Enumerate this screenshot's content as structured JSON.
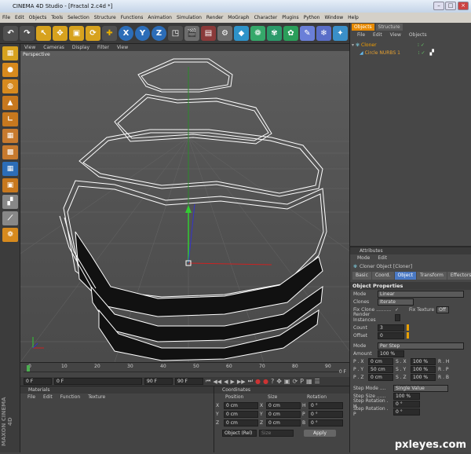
{
  "window": {
    "title": "CINEMA 4D Studio - [Fractal 2.c4d *]"
  },
  "menu": [
    "File",
    "Edit",
    "Objects",
    "Tools",
    "Selection",
    "Structure",
    "Functions",
    "Animation",
    "Simulation",
    "Render",
    "MoGraph",
    "Character",
    "Plugins",
    "Python",
    "Window",
    "Help"
  ],
  "viewport": {
    "menu": [
      "View",
      "Cameras",
      "Display",
      "Filter",
      "View"
    ],
    "label": "Perspective"
  },
  "timeline": {
    "ticks": [
      "0",
      "10",
      "20",
      "30",
      "40",
      "50",
      "60",
      "70",
      "80",
      "90"
    ],
    "end_label": "0 F",
    "start_field": "0 F",
    "cur_field": "0 F",
    "min_field": "90 F",
    "max_field": "90 F"
  },
  "materials": {
    "title": "Materials",
    "menu": [
      "File",
      "Edit",
      "Function",
      "Texture"
    ]
  },
  "coords": {
    "title": "Coordinates",
    "headers": [
      "Position",
      "Size",
      "Rotation"
    ],
    "rows": [
      {
        "axis": "X",
        "pos": "0 cm",
        "sz": "0 cm",
        "rl": "H",
        "rot": "0 °"
      },
      {
        "axis": "Y",
        "pos": "0 cm",
        "sz": "0 cm",
        "rl": "P",
        "rot": "0 °"
      },
      {
        "axis": "Z",
        "pos": "0 cm",
        "sz": "0 cm",
        "rl": "B",
        "rot": "0 °"
      }
    ],
    "mode": "Object (Rel)",
    "size_mode": "Size",
    "apply": "Apply"
  },
  "objects": {
    "tabs": [
      "Objects",
      "Structure"
    ],
    "menu": [
      "File",
      "Edit",
      "View",
      "Objects"
    ],
    "items": [
      {
        "name": "Cloner"
      },
      {
        "name": "Circle NURBS 1"
      }
    ]
  },
  "attributes": {
    "title": "Attributes",
    "menu": [
      "Mode",
      "Edit"
    ],
    "object_label": "Cloner Object [Cloner]",
    "tabs": [
      "Basic",
      "Coord.",
      "Object",
      "Transform",
      "Effectors"
    ],
    "section": "Object Properties",
    "mode_label": "Mode",
    "mode_value": "Linear",
    "clones_label": "Clones",
    "clones_value": "Iterate",
    "fix_clone": "Fix Clone ..........",
    "fix_texture": "Fix Texture",
    "fix_texture_value": "Off",
    "render_instances": "Render Instances",
    "count_label": "Count",
    "count_value": "3",
    "offset_label": "Offset",
    "offset_value": "0",
    "mode2_label": "Mode",
    "mode2_value": "Per Step",
    "amount_label": "Amount",
    "amount_value": "100 %",
    "grid": [
      {
        "l1": "P . X",
        "v1": "0 cm",
        "l2": "S . X",
        "v2": "100 %",
        "l3": "R . H"
      },
      {
        "l1": "P . Y",
        "v1": "50 cm",
        "l2": "S . Y",
        "v2": "100 %",
        "l3": "R . P"
      },
      {
        "l1": "P . Z",
        "v1": "0 cm",
        "l2": "S . Z",
        "v2": "100 %",
        "l3": "R . B"
      }
    ],
    "step_mode_label": "Step Mode ....",
    "step_mode_value": "Single Value",
    "step_size_label": "Step Size ......",
    "step_size_value": "100 %",
    "step_rot_h_label": "Step Rotation . H",
    "step_rot_h_value": "0 °",
    "step_rot_p_label": "Step Rotation . P",
    "step_rot_p_value": "0 °"
  },
  "maxon": "MAXON CINEMA 4D",
  "watermark": "pxleyes.com"
}
